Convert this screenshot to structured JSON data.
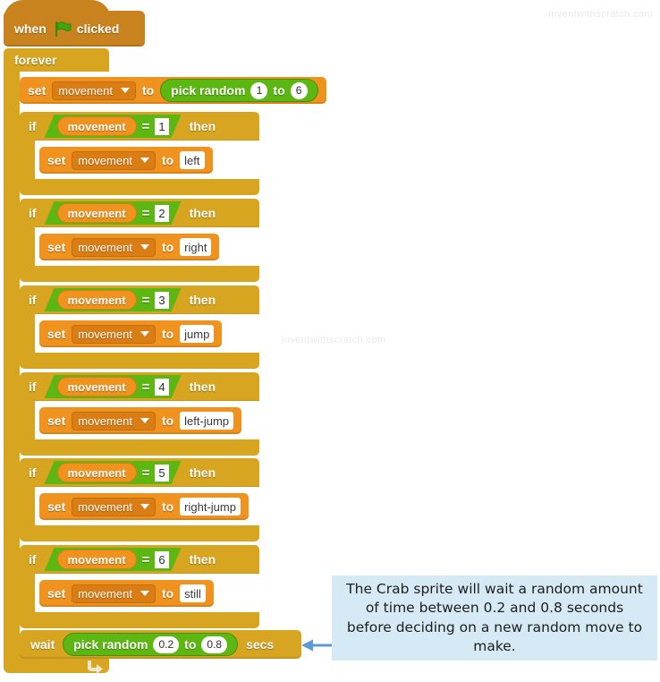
{
  "watermarks": {
    "top_right": "inventwithscratch.com",
    "center": "inventwithscratch.com",
    "bottom_left": "inventwithscratch.com"
  },
  "colors": {
    "events_block": "#c8831f",
    "control_block": "#d8a521",
    "variables_block": "#f0921e",
    "operators_block": "#5cb712",
    "callout_bg": "#d6eaf5",
    "arrow": "#5b9bd5",
    "canvas": "#ffffff"
  },
  "script": {
    "hat": {
      "word_when": "when",
      "icon": "green-flag-icon",
      "word_clicked": "clicked"
    },
    "forever": {
      "label": "forever",
      "loop_icon": "loop-arrow-icon"
    },
    "set_random": {
      "keyword": "set",
      "variable": "movement",
      "to": "to",
      "operator": {
        "label": "pick random",
        "from": "1",
        "joiner": "to",
        "to": "6"
      }
    },
    "conditionals": [
      {
        "if": "if",
        "variable": "movement",
        "operator": "=",
        "compare_value": "1",
        "then": "then",
        "body": {
          "keyword": "set",
          "variable": "movement",
          "to": "to",
          "value": "left"
        }
      },
      {
        "if": "if",
        "variable": "movement",
        "operator": "=",
        "compare_value": "2",
        "then": "then",
        "body": {
          "keyword": "set",
          "variable": "movement",
          "to": "to",
          "value": "right"
        }
      },
      {
        "if": "if",
        "variable": "movement",
        "operator": "=",
        "compare_value": "3",
        "then": "then",
        "body": {
          "keyword": "set",
          "variable": "movement",
          "to": "to",
          "value": "jump"
        }
      },
      {
        "if": "if",
        "variable": "movement",
        "operator": "=",
        "compare_value": "4",
        "then": "then",
        "body": {
          "keyword": "set",
          "variable": "movement",
          "to": "to",
          "value": "left-jump"
        }
      },
      {
        "if": "if",
        "variable": "movement",
        "operator": "=",
        "compare_value": "5",
        "then": "then",
        "body": {
          "keyword": "set",
          "variable": "movement",
          "to": "to",
          "value": "right-jump"
        }
      },
      {
        "if": "if",
        "variable": "movement",
        "operator": "=",
        "compare_value": "6",
        "then": "then",
        "body": {
          "keyword": "set",
          "variable": "movement",
          "to": "to",
          "value": "still"
        }
      }
    ],
    "wait": {
      "keyword": "wait",
      "operator": {
        "label": "pick random",
        "from": "0.2",
        "joiner": "to",
        "to": "0.8"
      },
      "unit": "secs"
    }
  },
  "callout": {
    "text": "The Crab sprite will wait a random amount of time between 0.2 and 0.8 seconds before deciding on a new random move to make.",
    "arrow_icon": "left-arrow-icon"
  }
}
